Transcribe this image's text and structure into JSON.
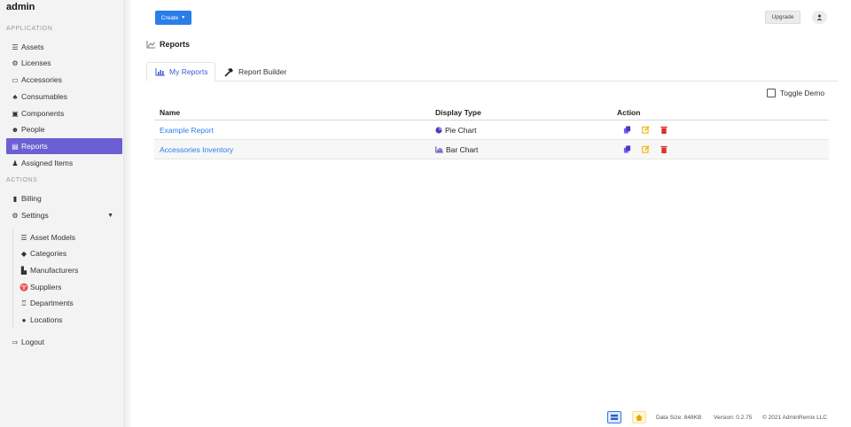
{
  "sidebar": {
    "brand": "admin",
    "section_application": "APPLICATION",
    "section_actions": "ACTIONS",
    "items": [
      {
        "label": "Assets",
        "icon": "list-icon"
      },
      {
        "label": "Licenses",
        "icon": "badge-icon"
      },
      {
        "label": "Accessories",
        "icon": "keyboard-icon"
      },
      {
        "label": "Consumables",
        "icon": "tint-icon"
      },
      {
        "label": "Components",
        "icon": "memory-icon"
      },
      {
        "label": "People",
        "icon": "users-icon"
      },
      {
        "label": "Reports",
        "icon": "file-icon",
        "active": true
      },
      {
        "label": "Assigned Items",
        "icon": "user-tag-icon"
      }
    ],
    "actions": [
      {
        "label": "Billing",
        "icon": "receipt-icon"
      },
      {
        "label": "Settings",
        "icon": "gears-icon"
      }
    ],
    "settings_sub": [
      {
        "label": "Asset Models",
        "icon": "list-icon"
      },
      {
        "label": "Categories",
        "icon": "shapes-icon"
      },
      {
        "label": "Manufacturers",
        "icon": "industry-icon"
      },
      {
        "label": "Suppliers",
        "icon": "parachute-icon"
      },
      {
        "label": "Departments",
        "icon": "building-icon"
      },
      {
        "label": "Locations",
        "icon": "compass-icon"
      }
    ],
    "logout": "Logout"
  },
  "topbar": {
    "create_label": "Create",
    "upgrade_label": "Upgrade"
  },
  "page": {
    "title": "Reports",
    "tabs": [
      {
        "label": "My Reports",
        "active": true
      },
      {
        "label": "Report Builder",
        "active": false
      }
    ],
    "toggle_label": "Toggle Demo"
  },
  "table": {
    "headers": [
      "Name",
      "Display Type",
      "Action"
    ],
    "rows": [
      {
        "name": "Example Report",
        "display_type": "Pie Chart",
        "type_icon": "pie-chart-icon"
      },
      {
        "name": "Accessories Inventory",
        "display_type": "Bar Chart",
        "type_icon": "bar-chart-icon"
      }
    ]
  },
  "footer": {
    "data_size": "Data Size: 848KB",
    "version": "Version: 0.2.75",
    "copyright": "© 2021 AdminRemix LLC"
  },
  "colors": {
    "accent": "#6c5fd3",
    "primary": "#2b7de9",
    "copy_icon": "#6a4ee0",
    "edit_icon": "#f0b400",
    "delete_icon": "#d9302c"
  }
}
